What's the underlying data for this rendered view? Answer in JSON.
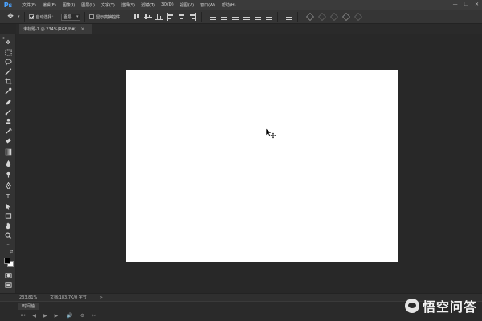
{
  "app": {
    "logo_text": "Ps",
    "menu": [
      "文件(F)",
      "编辑(E)",
      "图像(I)",
      "图层(L)",
      "文字(Y)",
      "选择(S)",
      "滤镜(T)",
      "3D(D)",
      "视图(V)",
      "窗口(W)",
      "帮助(H)"
    ],
    "window_controls": {
      "minimize": "—",
      "restore": "❐",
      "close": "✕"
    }
  },
  "options_bar": {
    "auto_select_label": "自动选择：",
    "auto_select_checked": true,
    "auto_select_target": "图层",
    "show_transform_label": "显示变换控件",
    "show_transform_checked": false
  },
  "document_tab": {
    "title": "未标题-1 @ 234%(RGB/8#)",
    "close_glyph": "×"
  },
  "toolbar": {
    "collapse_glyph": "▸▸",
    "tools": [
      "move-tool",
      "rectangular-marquee-tool",
      "lasso-tool",
      "magic-wand-tool",
      "crop-tool",
      "eyedropper-tool",
      "healing-brush-tool",
      "brush-tool",
      "clone-stamp-tool",
      "history-brush-tool",
      "eraser-tool",
      "gradient-tool",
      "blur-tool",
      "dodge-tool",
      "pen-tool",
      "type-tool",
      "path-selection-tool",
      "rectangle-tool",
      "hand-tool",
      "zoom-tool",
      "edit-toolbar",
      "swap-colors",
      "quick-mask",
      "screen-mode"
    ],
    "tool_glyphs": {
      "type": "T",
      "more": "···"
    },
    "foreground_color": "#000000",
    "background_color": "#ffffff"
  },
  "canvas": {
    "background_color": "#ffffff",
    "workspace_color": "#282828"
  },
  "status_bar": {
    "zoom": "233.81%",
    "doc_info": "文档:183.7K/0 字节",
    "arrow": ">"
  },
  "timeline": {
    "tab_label": "时间轴",
    "controls": [
      "⏮",
      "◀",
      "▶",
      "▶|",
      "🔊",
      "⚙",
      "✂"
    ]
  },
  "watermark": {
    "text": "悟空问答"
  }
}
